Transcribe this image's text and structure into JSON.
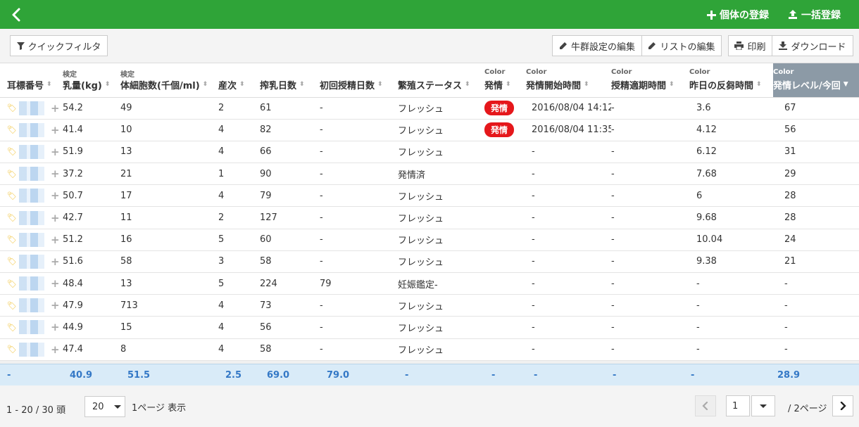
{
  "topbar": {
    "add_animal_label": "個体の登録",
    "bulk_register_label": "一括登録"
  },
  "toolbar": {
    "quick_filter_label": "クイックフィルタ",
    "herd_settings_label": "牛群設定の編集",
    "list_edit_label": "リストの編集",
    "print_label": "印刷",
    "download_label": "ダウンロード"
  },
  "table": {
    "columns": [
      {
        "pre": "",
        "label": "耳標番号"
      },
      {
        "pre": "検定",
        "label": "乳量(kg)"
      },
      {
        "pre": "検定",
        "label": "体細胞数(千個/ml)"
      },
      {
        "pre": "",
        "label": "産次"
      },
      {
        "pre": "",
        "label": "搾乳日数"
      },
      {
        "pre": "",
        "label": "初回授精日数"
      },
      {
        "pre": "",
        "label": "繁殖ステータス"
      },
      {
        "pre": "Color",
        "label": "発情"
      },
      {
        "pre": "Color",
        "label": "発情開始時間"
      },
      {
        "pre": "Color",
        "label": "授精適期時間"
      },
      {
        "pre": "Color",
        "label": "昨日の反芻時間"
      },
      {
        "pre": "Color",
        "label": "発情レベル/今回"
      }
    ],
    "rows": [
      {
        "milk": "54.2",
        "scc": "49",
        "parity": "2",
        "dim": "61",
        "first_ai": "-",
        "status": "フレッシュ",
        "estrus": "発情",
        "estrus_start": "2016/08/04 14:12",
        "ai_window": "-",
        "rumination": "3.6",
        "level": "67"
      },
      {
        "milk": "41.4",
        "scc": "10",
        "parity": "4",
        "dim": "82",
        "first_ai": "-",
        "status": "フレッシュ",
        "estrus": "発情",
        "estrus_start": "2016/08/04 11:35",
        "ai_window": "-",
        "rumination": "4.12",
        "level": "56"
      },
      {
        "milk": "51.9",
        "scc": "13",
        "parity": "4",
        "dim": "66",
        "first_ai": "-",
        "status": "フレッシュ",
        "estrus": "",
        "estrus_start": "-",
        "ai_window": "-",
        "rumination": "6.12",
        "level": "31"
      },
      {
        "milk": "37.2",
        "scc": "21",
        "parity": "1",
        "dim": "90",
        "first_ai": "-",
        "status": "発情済",
        "estrus": "",
        "estrus_start": "-",
        "ai_window": "-",
        "rumination": "7.68",
        "level": "29"
      },
      {
        "milk": "50.7",
        "scc": "17",
        "parity": "4",
        "dim": "79",
        "first_ai": "-",
        "status": "フレッシュ",
        "estrus": "",
        "estrus_start": "-",
        "ai_window": "-",
        "rumination": "6",
        "level": "28"
      },
      {
        "milk": "42.7",
        "scc": "11",
        "parity": "2",
        "dim": "127",
        "first_ai": "-",
        "status": "フレッシュ",
        "estrus": "",
        "estrus_start": "-",
        "ai_window": "-",
        "rumination": "9.68",
        "level": "28"
      },
      {
        "milk": "51.2",
        "scc": "16",
        "parity": "5",
        "dim": "60",
        "first_ai": "-",
        "status": "フレッシュ",
        "estrus": "",
        "estrus_start": "-",
        "ai_window": "-",
        "rumination": "10.04",
        "level": "24"
      },
      {
        "milk": "51.6",
        "scc": "58",
        "parity": "3",
        "dim": "58",
        "first_ai": "-",
        "status": "フレッシュ",
        "estrus": "",
        "estrus_start": "-",
        "ai_window": "-",
        "rumination": "9.38",
        "level": "21"
      },
      {
        "milk": "48.4",
        "scc": "13",
        "parity": "5",
        "dim": "224",
        "first_ai": "79",
        "status": "妊娠鑑定-",
        "estrus": "",
        "estrus_start": "-",
        "ai_window": "-",
        "rumination": "-",
        "level": "-"
      },
      {
        "milk": "47.9",
        "scc": "713",
        "parity": "4",
        "dim": "73",
        "first_ai": "-",
        "status": "フレッシュ",
        "estrus": "",
        "estrus_start": "-",
        "ai_window": "-",
        "rumination": "-",
        "level": "-"
      },
      {
        "milk": "44.9",
        "scc": "15",
        "parity": "4",
        "dim": "56",
        "first_ai": "-",
        "status": "フレッシュ",
        "estrus": "",
        "estrus_start": "-",
        "ai_window": "-",
        "rumination": "-",
        "level": "-"
      },
      {
        "milk": "47.4",
        "scc": "8",
        "parity": "4",
        "dim": "58",
        "first_ai": "-",
        "status": "フレッシュ",
        "estrus": "",
        "estrus_start": "-",
        "ai_window": "-",
        "rumination": "-",
        "level": "-"
      }
    ]
  },
  "summary": {
    "id": "-",
    "milk": "40.9",
    "scc": "51.5",
    "parity": "2.5",
    "dim": "69.0",
    "first_ai": "79.0",
    "status": "-",
    "estrus": "-",
    "estrus_start": "-",
    "ai_window": "-",
    "rumination": "-",
    "level": "28.9"
  },
  "pager": {
    "range": "1 - 20 / 30 頭",
    "page_size": "20",
    "per_page_label": "1ページ 表示",
    "current_page": "1",
    "total_pages_label": "/ 2ページ"
  },
  "colors": {
    "topbar": "#2fa438",
    "estrus_badge": "#e5171b",
    "summary_text": "#3478c6",
    "active_header": "#8c9aa6"
  }
}
